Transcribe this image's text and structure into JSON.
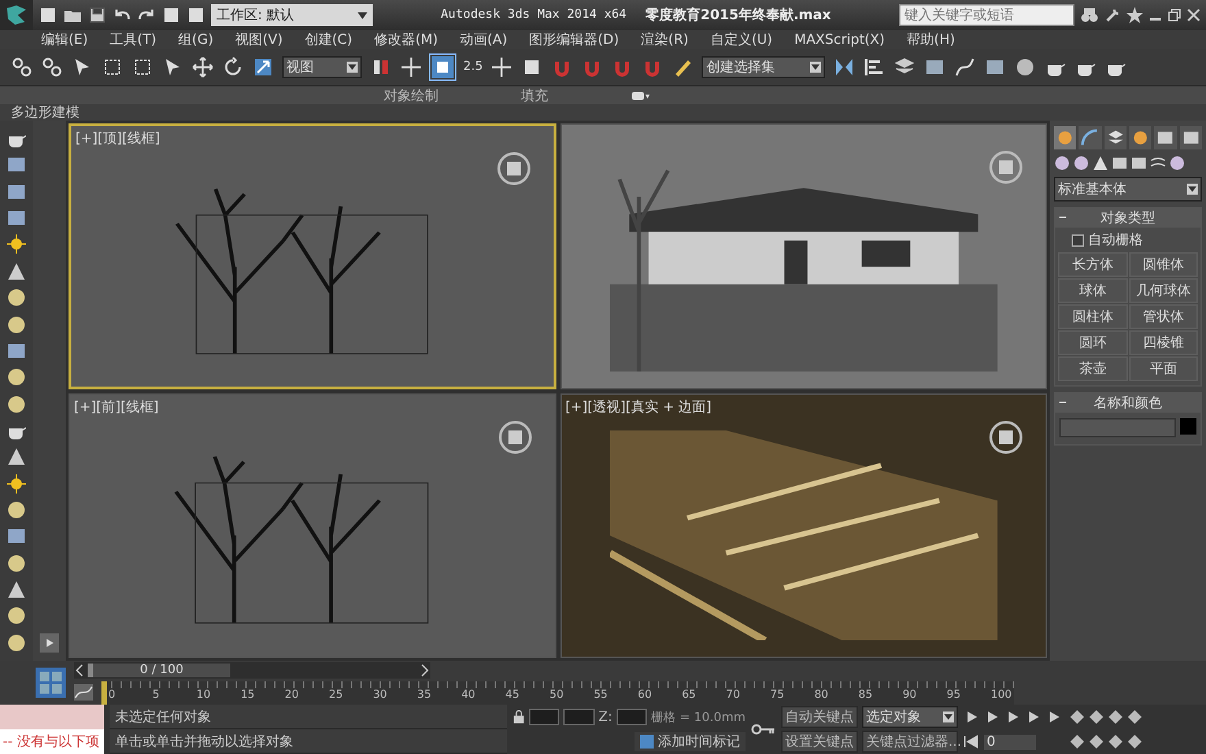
{
  "title_bar": {
    "workspace": "工作区: 默认",
    "app_title": "Autodesk 3ds Max  2014 x64",
    "file_name": "零度教育2015年终奉献.max",
    "search": {
      "placeholder": "键入关键字或短语"
    }
  },
  "menu": [
    "编辑(E)",
    "工具(T)",
    "组(G)",
    "视图(V)",
    "创建(C)",
    "修改器(M)",
    "动画(A)",
    "图形编辑器(D)",
    "渲染(R)",
    "自定义(U)",
    "MAXScript(X)",
    "帮助(H)"
  ],
  "toolbar": {
    "reference_dropdown": "视图",
    "angle_snap_label": "2.5",
    "selection_set_dropdown": "创建选择集"
  },
  "ribbon": {
    "tabs": [
      "对象绘制",
      "填充"
    ],
    "panel_label": "多边形建模"
  },
  "viewports": [
    {
      "label": "[+][顶][线框]",
      "kind": "wireframe",
      "active": true
    },
    {
      "kind": "edged",
      "active": false
    },
    {
      "label": "[+][前][线框]",
      "kind": "wireframe",
      "active": false
    },
    {
      "label": "[+][透视][真实 + 边面]",
      "kind": "realistic",
      "active": false
    }
  ],
  "command_panel": {
    "category_dropdown": "标准基本体",
    "object_type": {
      "title": "对象类型",
      "autogrid": {
        "label": "自动栅格",
        "checked": false
      },
      "buttons": [
        "长方体",
        "圆锥体",
        "球体",
        "几何球体",
        "圆柱体",
        "管状体",
        "圆环",
        "四棱锥",
        "茶壶",
        "平面"
      ]
    },
    "name_color": {
      "title": "名称和颜色"
    }
  },
  "timeline": {
    "frame_counter": "0 / 100",
    "level": 0,
    "ticks": [
      "0",
      "5",
      "10",
      "15",
      "20",
      "25",
      "30",
      "35",
      "40",
      "45",
      "50",
      "55",
      "60",
      "65",
      "70",
      "75",
      "80",
      "85",
      "90",
      "95",
      "100"
    ]
  },
  "status": {
    "listener_text": "-- 没有与以下项",
    "selection_status": "未选定任何对象",
    "prompt": "单击或单击并拖动以选择对象",
    "z_label": "Z:",
    "grid": "栅格 = 10.0mm",
    "add_time_tag": "添加时间标记",
    "auto_key": "自动关键点",
    "key_mode_dropdown": "选定对象",
    "set_key": "设置关键点",
    "key_filters": "关键点过滤器...",
    "current_frame": "0"
  }
}
